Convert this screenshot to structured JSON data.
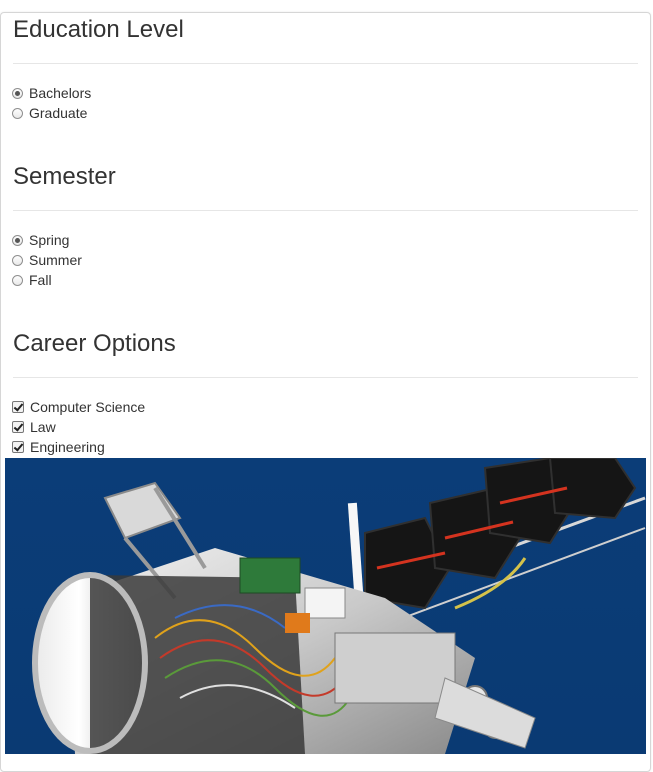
{
  "education": {
    "title": "Education Level",
    "options": [
      {
        "label": "Bachelors",
        "selected": true
      },
      {
        "label": "Graduate",
        "selected": false
      }
    ]
  },
  "semester": {
    "title": "Semester",
    "options": [
      {
        "label": "Spring",
        "selected": true
      },
      {
        "label": "Summer",
        "selected": false
      },
      {
        "label": "Fall",
        "selected": false
      }
    ]
  },
  "career": {
    "title": "Career Options",
    "options": [
      {
        "label": "Computer Science",
        "checked": true
      },
      {
        "label": "Law",
        "checked": true
      },
      {
        "label": "Engineering",
        "checked": true
      }
    ]
  },
  "image": {
    "subject": "robot-photo",
    "background_color": "#0b3f7a"
  }
}
